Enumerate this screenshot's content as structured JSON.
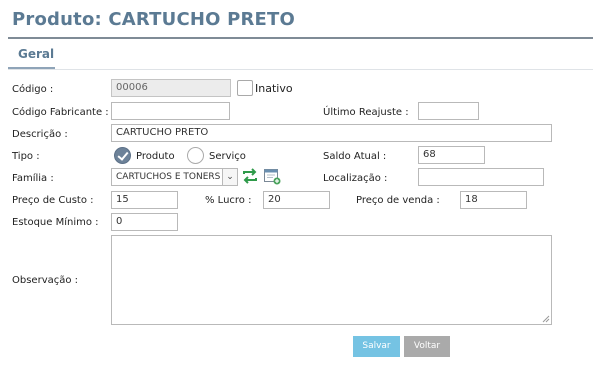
{
  "page": {
    "title": "Produto: CARTUCHO PRETO"
  },
  "tabs": [
    {
      "label": "Geral"
    }
  ],
  "form": {
    "codigo_label": "Código :",
    "codigo_value": "00006",
    "inativo_label": "Inativo",
    "codigo_fabricante_label": "Código Fabricante :",
    "codigo_fabricante_value": "",
    "ultimo_reajuste_label": "Último Reajuste :",
    "ultimo_reajuste_value": "",
    "descricao_label": "Descrição :",
    "descricao_value": "CARTUCHO PRETO",
    "tipo_label": "Tipo :",
    "tipo_options": [
      "Produto",
      "Serviço"
    ],
    "tipo_selected": "Produto",
    "saldo_atual_label": "Saldo Atual :",
    "saldo_atual_value": "68",
    "familia_label": "Família :",
    "familia_value": "CARTUCHOS E TONERS",
    "localizacao_label": "Localização :",
    "localizacao_value": "",
    "preco_custo_label": "Preço de Custo :",
    "preco_custo_value": "15",
    "lucro_label": "% Lucro :",
    "lucro_value": "20",
    "preco_venda_label": "Preço de venda :",
    "preco_venda_value": "18",
    "estoque_minimo_label": "Estoque Mínimo :",
    "estoque_minimo_value": "0",
    "observacao_label": "Observação :",
    "observacao_value": ""
  },
  "actions": {
    "save_label": "Salvar",
    "back_label": "Voltar"
  },
  "colors": {
    "title": "#5b7a93",
    "save_button": "#75c3e3",
    "back_button": "#aaaaaa",
    "refresh_icon": "#2f9a4a"
  }
}
